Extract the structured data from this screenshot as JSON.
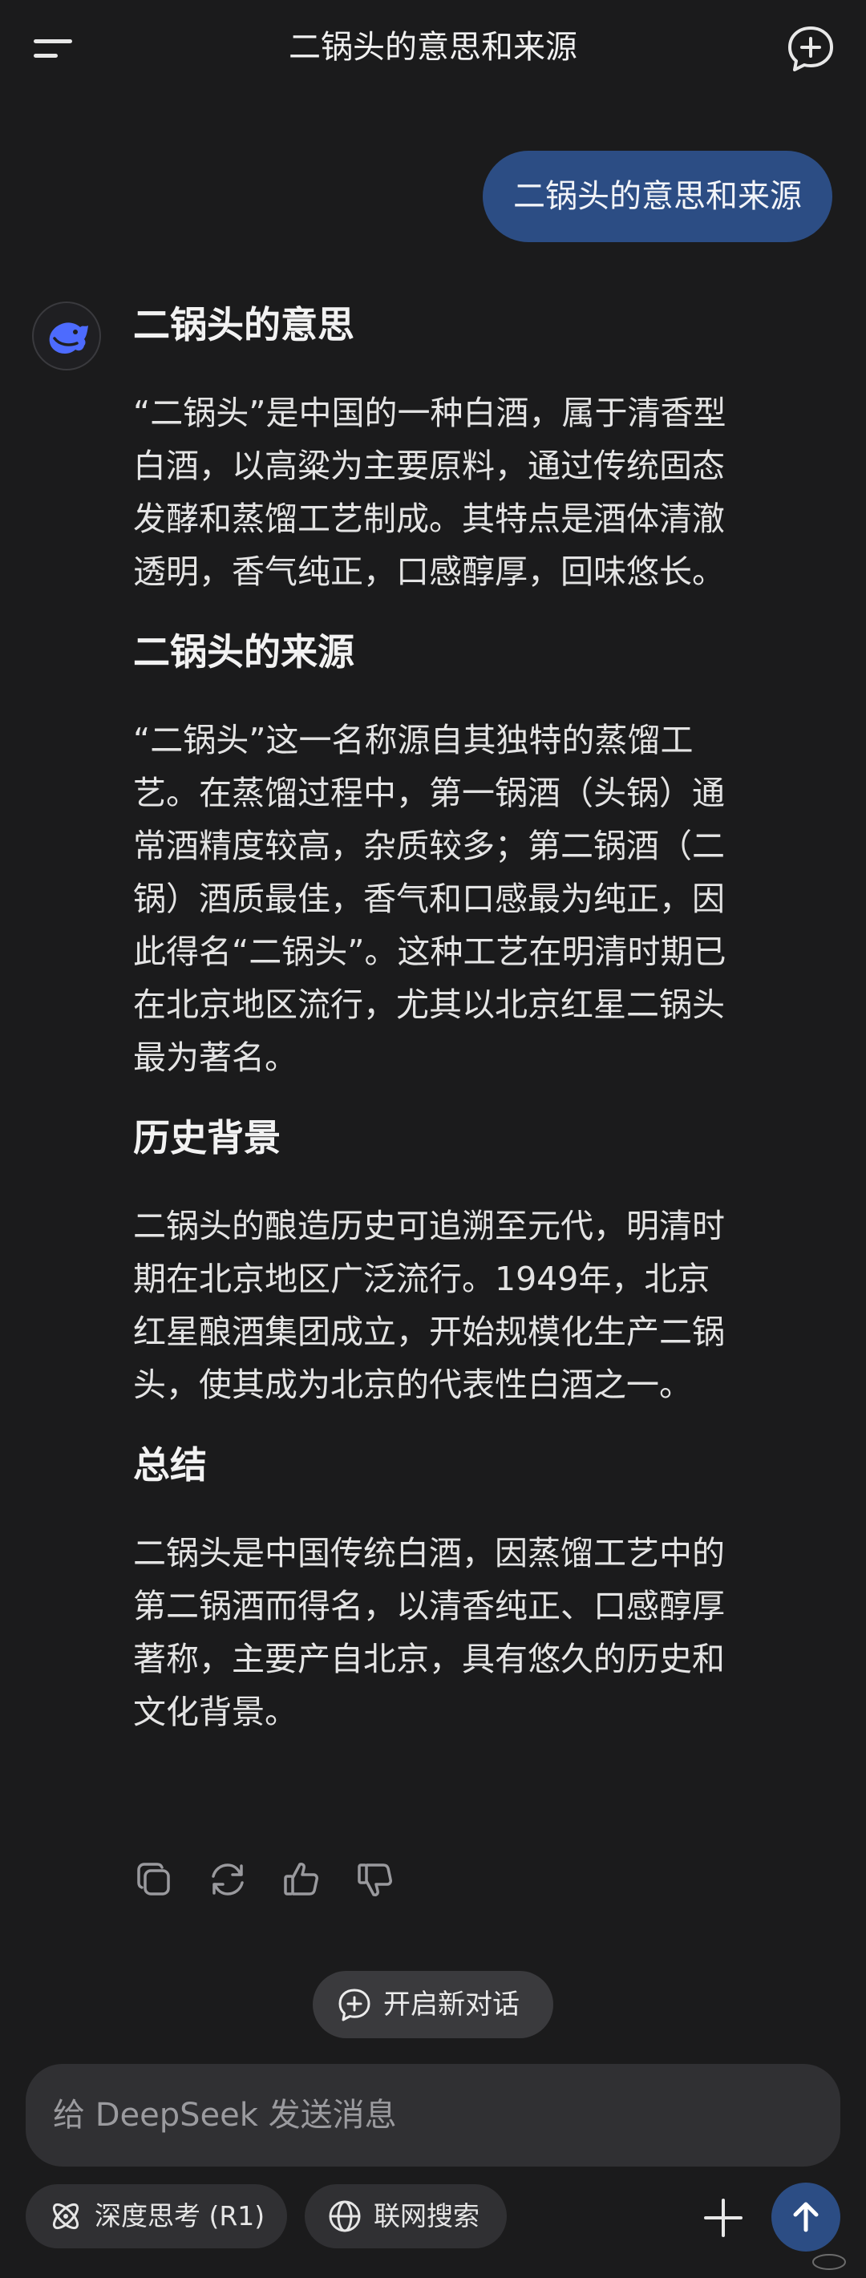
{
  "header": {
    "title": "二锅头的意思和来源",
    "menu_icon": "menu-icon",
    "new_chat_icon": "chat-plus-icon"
  },
  "user_message": "二锅头的意思和来源",
  "answer": {
    "sections": [
      {
        "heading": "二锅头的意思",
        "lines": [
          "“二锅头”是中国的一种白酒，属于清香型",
          "白酒，以高粱为主要原料，通过传统固态",
          "发酵和蒸馏工艺制成。其特点是酒体清澈",
          "透明，香气纯正，口感醇厚，回味悠长。"
        ]
      },
      {
        "heading": "二锅头的来源",
        "lines": [
          "“二锅头”这一名称源自其独特的蒸馏工",
          "艺。在蒸馏过程中，第一锅酒（头锅）通",
          "常酒精度较高，杂质较多；第二锅酒（二",
          "锅）酒质最佳，香气和口感最为纯正，因",
          "此得名“二锅头”。这种工艺在明清时期已",
          "在北京地区流行，尤其以北京红星二锅头",
          "最为著名。"
        ]
      },
      {
        "heading": "历史背景",
        "lines": [
          "二锅头的酿造历史可追溯至元代，明清时",
          "期在北京地区广泛流行。1949年，北京",
          "红星酿酒集团成立，开始规模化生产二锅",
          "头，使其成为北京的代表性白酒之一。"
        ]
      },
      {
        "heading": "总结",
        "lines": [
          "二锅头是中国传统白酒，因蒸馏工艺中的",
          "第二锅酒而得名，以清香纯正、口感醇厚",
          "著称，主要产自北京，具有悠久的历史和",
          "文化背景。"
        ]
      }
    ]
  },
  "actions": [
    "copy-icon",
    "regenerate-icon",
    "thumbs-up-icon",
    "thumbs-down-icon"
  ],
  "new_conversation_label": "开启新对话",
  "composer": {
    "placeholder": "给 DeepSeek 发送消息",
    "deep_think_label": "深度思考 (R1)",
    "web_search_label": "联网搜索"
  },
  "colors": {
    "background": "#1b1b1c",
    "accent": "#2c4d84",
    "logo": "#4d6bfe"
  }
}
